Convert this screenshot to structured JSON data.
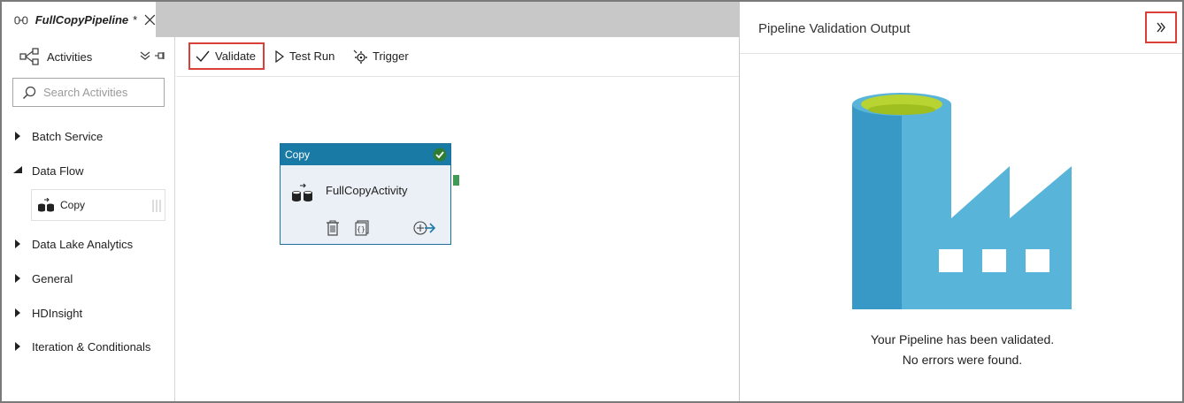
{
  "tab": {
    "title": "FullCopyPipeline",
    "dirty": "*"
  },
  "activities": {
    "title": "Activities",
    "search_placeholder": "Search Activities",
    "categories": [
      {
        "label": "Batch Service",
        "expanded": false
      },
      {
        "label": "Data Flow",
        "expanded": true
      },
      {
        "label": "Data Lake Analytics",
        "expanded": false
      },
      {
        "label": "General",
        "expanded": false
      },
      {
        "label": "HDInsight",
        "expanded": false
      },
      {
        "label": "Iteration & Conditionals",
        "expanded": false
      }
    ],
    "data_flow_items": [
      {
        "label": "Copy"
      }
    ]
  },
  "toolbar": {
    "validate": "Validate",
    "test_run": "Test Run",
    "trigger": "Trigger"
  },
  "node": {
    "type": "Copy",
    "name": "FullCopyActivity",
    "status": "validated"
  },
  "validation": {
    "title": "Pipeline Validation Output",
    "line1": "Your Pipeline has been validated.",
    "line2": "No errors were found."
  },
  "colors": {
    "accent": "#1a7aa6",
    "highlight": "#d9403a",
    "success": "#3f9a56",
    "factory_dark": "#3999c6",
    "factory_light": "#59b4d9",
    "factory_top": "#b8d432"
  }
}
